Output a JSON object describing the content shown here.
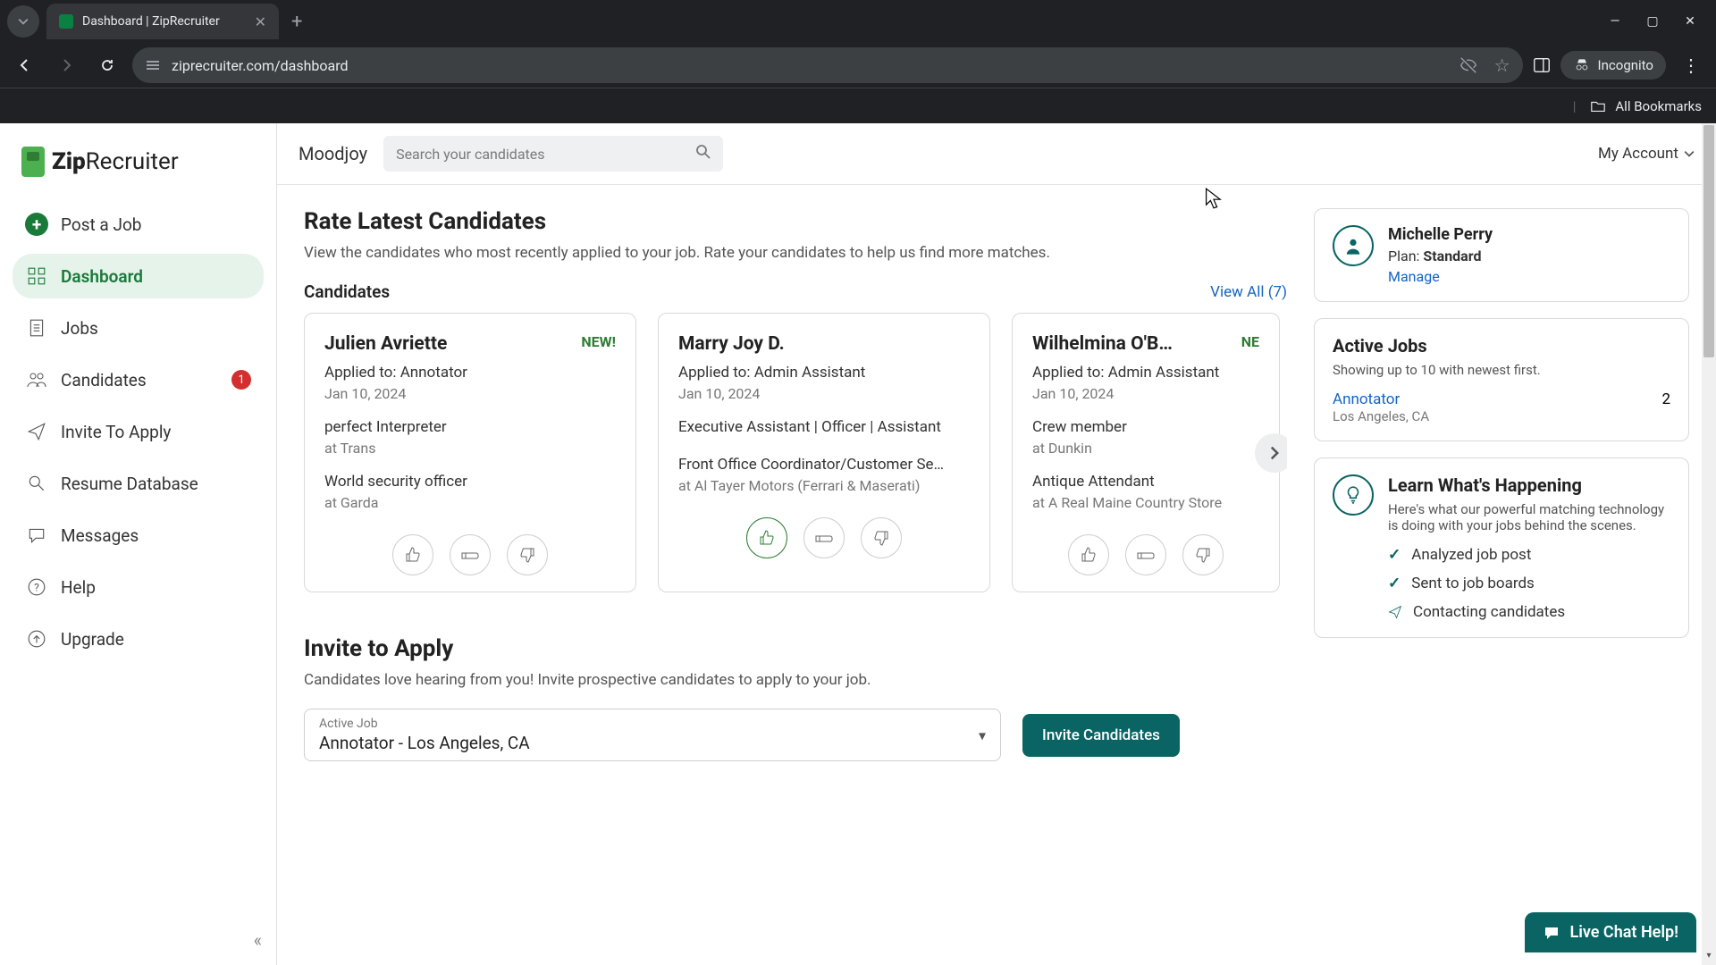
{
  "browser": {
    "tab_title": "Dashboard | ZipRecruiter",
    "url": "ziprecruiter.com/dashboard",
    "incognito_label": "Incognito",
    "all_bookmarks": "All Bookmarks"
  },
  "logo_text_1": "Zip",
  "logo_text_2": "Recruiter",
  "sidebar": {
    "items": [
      {
        "label": "Post a Job"
      },
      {
        "label": "Dashboard"
      },
      {
        "label": "Jobs"
      },
      {
        "label": "Candidates",
        "badge": "1"
      },
      {
        "label": "Invite To Apply"
      },
      {
        "label": "Resume Database"
      },
      {
        "label": "Messages"
      },
      {
        "label": "Help"
      },
      {
        "label": "Upgrade"
      }
    ]
  },
  "topbar": {
    "org": "Moodjoy",
    "search_placeholder": "Search your candidates",
    "account": "My Account"
  },
  "rate": {
    "title": "Rate Latest Candidates",
    "subtitle": "View the candidates who most recently applied to your job. Rate your candidates to help us find more matches.",
    "candidates_label": "Candidates",
    "view_all": "View All (7)"
  },
  "cards": [
    {
      "name": "Julien Avriette",
      "new": "NEW!",
      "applied": "Applied to: Annotator",
      "date": "Jan 10, 2024",
      "role1": "perfect Interpreter",
      "at1": "at Trans",
      "role2": "World security officer",
      "at2": "at Garda"
    },
    {
      "name": "Marry Joy D.",
      "new": "",
      "applied": "Applied to: Admin Assistant",
      "date": "Jan 10, 2024",
      "role1": "Executive Assistant | Officer | Assistant",
      "at1": "",
      "role2": "Front Office Coordinator/Customer Se…",
      "at2": "at Al Tayer Motors (Ferrari & Maserati)"
    },
    {
      "name": "Wilhelmina O'B…",
      "new": "NE",
      "applied": "Applied to: Admin Assistant",
      "date": "Jan 10, 2024",
      "role1": "Crew member",
      "at1": "at Dunkin",
      "role2": "Antique Attendant",
      "at2": "at A Real Maine Country Store"
    }
  ],
  "invite": {
    "title": "Invite to Apply",
    "subtitle": "Candidates love hearing from you! Invite prospective candidates to apply to your job.",
    "select_label": "Active Job",
    "select_value": "Annotator - Los Angeles, CA",
    "button": "Invite Candidates"
  },
  "user_panel": {
    "name": "Michelle Perry",
    "plan_label": "Plan: ",
    "plan_value": "Standard",
    "manage": "Manage"
  },
  "active_jobs": {
    "title": "Active Jobs",
    "subtitle": "Showing up to 10 with newest first.",
    "job_name": "Annotator",
    "job_count": "2",
    "job_loc": "Los Angeles, CA"
  },
  "learn": {
    "title": "Learn What's Happening",
    "subtitle": "Here's what our powerful matching technology is doing with your jobs behind the scenes.",
    "items": [
      "Analyzed job post",
      "Sent to job boards",
      "Contacting candidates"
    ]
  },
  "chat": "Live Chat Help!"
}
